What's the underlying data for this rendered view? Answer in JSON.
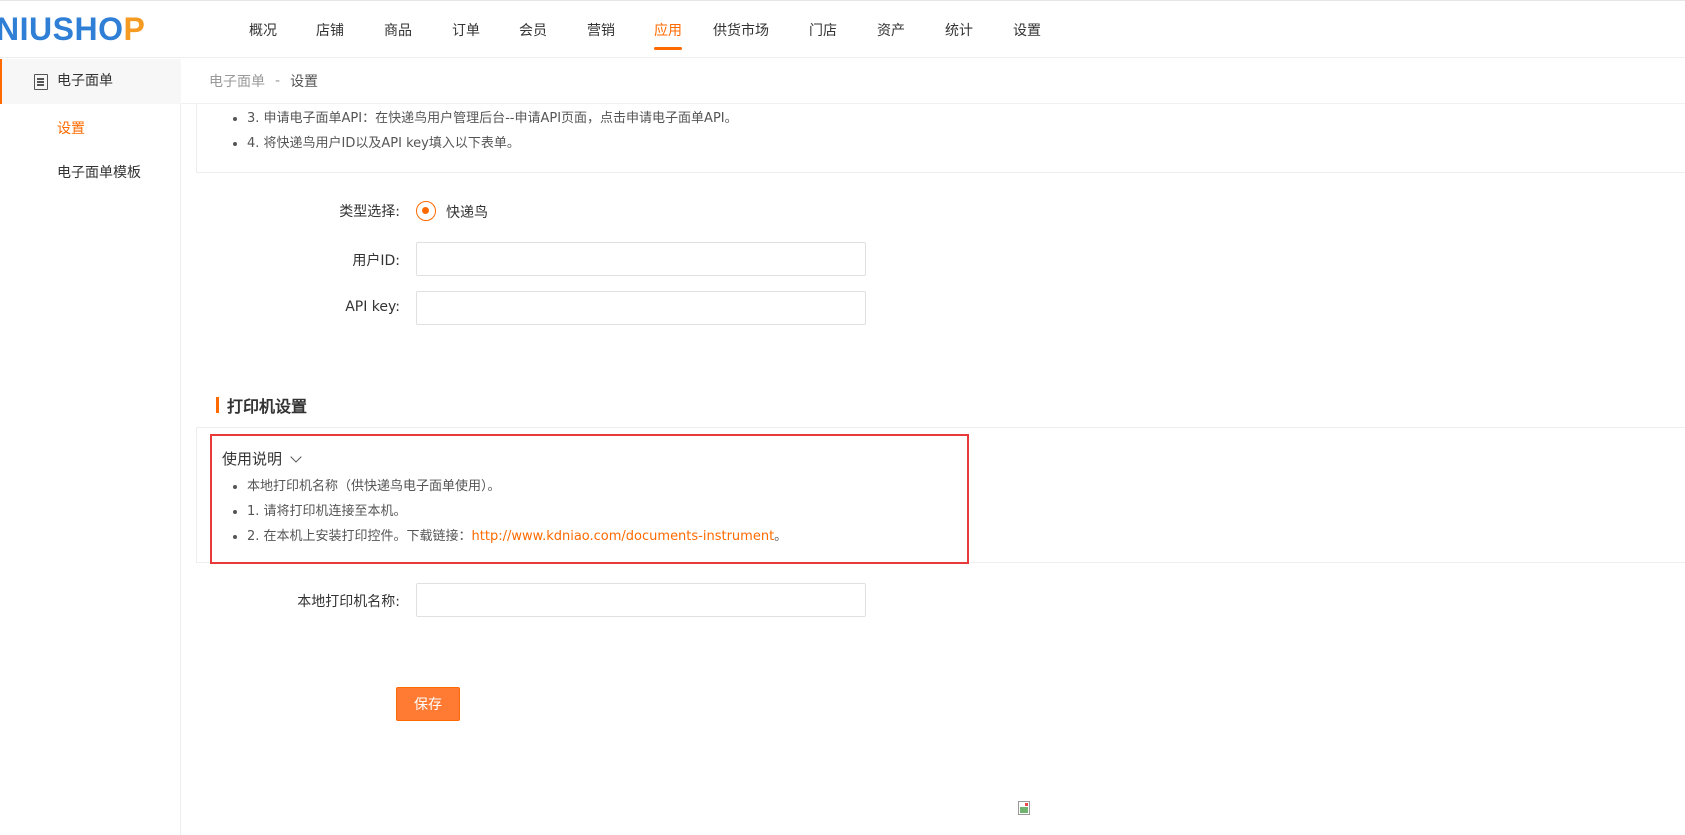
{
  "app": {
    "logo_left": "NIUSH",
    "logo_o": "O",
    "logo_right": "P"
  },
  "nav": {
    "items": [
      "概况",
      "店铺",
      "商品",
      "订单",
      "会员",
      "营销",
      "应用",
      "供货市场",
      "门店",
      "资产",
      "统计",
      "设置"
    ],
    "active": "应用"
  },
  "sidebar": {
    "header": "电子面单",
    "items": [
      "设置",
      "电子面单模板"
    ],
    "active": "设置"
  },
  "breadcrumb": {
    "parent": "电子面单",
    "separator": "-",
    "current": "设置"
  },
  "tips_top": [
    "3. 申请电子面单API：在快递鸟用户管理后台--申请API页面，点击申请电子面单API。",
    "4. 将快递鸟用户ID以及API key填入以下表单。"
  ],
  "form": {
    "type_label": "类型选择:",
    "type_option": "快递鸟",
    "userid_label": "用户ID:",
    "userid_value": "",
    "apikey_label": "API key:",
    "apikey_value": ""
  },
  "printer": {
    "section_title": "打印机设置",
    "usage_title": "使用说明",
    "tip_0": "本地打印机名称（供快递鸟电子面单使用）。",
    "tip_1": "1. 请将打印机连接至本机。",
    "tip_2_prefix": "2. 在本机上安装打印控件。下载链接：",
    "tip_2_link": "http://www.kdniao.com/documents-instrument",
    "tip_2_suffix": "。",
    "name_label": "本地打印机名称:",
    "name_value": ""
  },
  "actions": {
    "save_label": "保存"
  },
  "colors": {
    "accent": "#ff6a00",
    "highlight_border": "#e83a3a"
  }
}
